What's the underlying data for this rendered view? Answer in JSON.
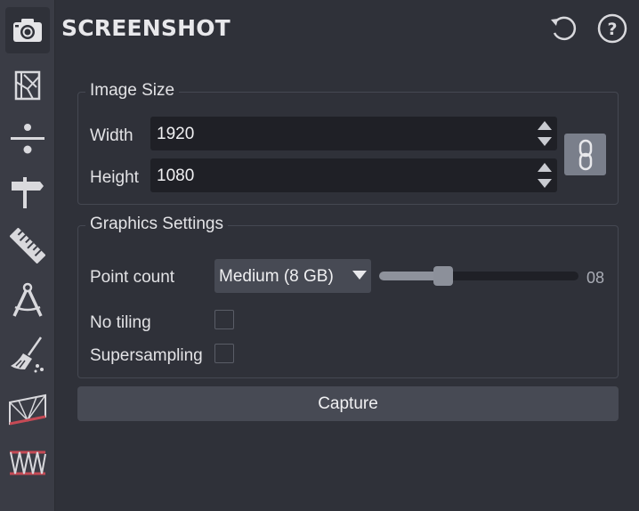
{
  "header": {
    "title": "SCREENSHOT",
    "reset_icon": "refresh-icon",
    "help_icon": "help-icon"
  },
  "toolbar": {
    "items": [
      {
        "name": "camera-icon",
        "active": true
      },
      {
        "name": "map-icon",
        "active": false
      },
      {
        "name": "divide-icon",
        "active": false
      },
      {
        "name": "signpost-icon",
        "active": false
      },
      {
        "name": "ruler-icon",
        "active": false
      },
      {
        "name": "compass-icon",
        "active": false
      },
      {
        "name": "broom-icon",
        "active": false
      },
      {
        "name": "flag-icon",
        "active": false
      },
      {
        "name": "zigzag-icon",
        "active": false
      }
    ]
  },
  "image_size": {
    "legend": "Image Size",
    "width_label": "Width",
    "width_value": "1920",
    "height_label": "Height",
    "height_value": "1080",
    "link_icon": "link-icon"
  },
  "graphics": {
    "legend": "Graphics Settings",
    "point_count_label": "Point count",
    "point_count_value": "Medium (8 GB)",
    "slider_value": "08",
    "slider_fraction": 0.32,
    "no_tiling_label": "No tiling",
    "no_tiling_checked": false,
    "supersampling_label": "Supersampling",
    "supersampling_checked": false
  },
  "capture_label": "Capture",
  "colors": {
    "background": "#2f3139",
    "toolbar": "#3a3c45",
    "field": "#1f2026",
    "button": "#474a54",
    "accent_red": "#c64a55"
  }
}
